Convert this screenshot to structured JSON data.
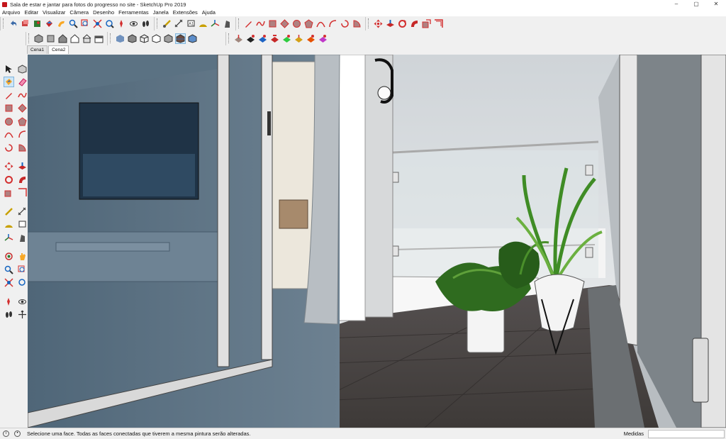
{
  "window": {
    "title": "Sala de estar e jantar para fotos do progresso no site - SketchUp Pro 2019",
    "minimize": "–",
    "maximize": "▢",
    "close": "✕"
  },
  "menu": [
    "Arquivo",
    "Editar",
    "Visualizar",
    "Câmera",
    "Desenho",
    "Ferramentas",
    "Janela",
    "Extensões",
    "Ajuda"
  ],
  "scenes": [
    "Cena1",
    "Cena2"
  ],
  "status": {
    "message": "Selecione uma face. Todas as faces conectadas que tiverem a mesma pintura serão alteradas.",
    "measurements_label": "Medidas",
    "measurements_value": ""
  },
  "colors": {
    "accent_red": "#c4161c",
    "tool_blue": "#2a6fb3",
    "floor": "#4a4542",
    "glass_tint": "#5a7184"
  }
}
